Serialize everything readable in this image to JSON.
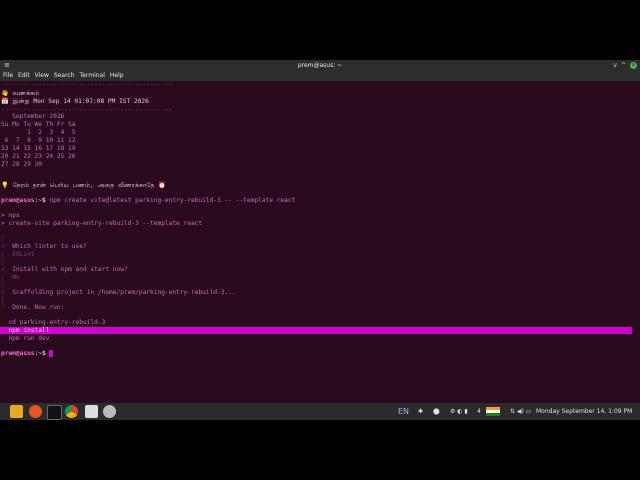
{
  "window": {
    "title": "prem@asus: ~",
    "controls": [
      "v",
      "^",
      "x"
    ]
  },
  "menu": [
    "File",
    "Edit",
    "View",
    "Search",
    "Terminal",
    "Help"
  ],
  "terminal": {
    "header_divider": "----------------------------------------------",
    "greeting_icon": "👋",
    "greeting": "வணக்கம்",
    "date_icon": "📅",
    "date_prefix": "இன்று",
    "date": "Mon Sep 14 01:07:08 PM IST 2026",
    "calendar": {
      "month": "   September 2026",
      "days_header": "Su Mo Tu We Th Fr Sa",
      "weeks": [
        "       1  2  3  4  5",
        " 6  7  8  9 10 11 12",
        "13 14 15 16 17 18 19",
        "20 21 22 23 24 25 26",
        "27 28 29 30"
      ]
    },
    "tip_icon": "💡",
    "tip": "நேரம் தான் பெரிய பணம், அதை வீணாக்காதே ⏰",
    "prompt_user": "prem@asus",
    "prompt_path": ":~$",
    "command": " npm create vite@latest parking-entry-rebuild-3 -- --template react",
    "npx_lines": [
      "> npx",
      "> create-vite parking-entry-rebuild-3 --template react"
    ],
    "wizard": [
      {
        "q": "Which linter to use?",
        "a": "ESLint"
      },
      {
        "q": "Install with npm and start now?",
        "a": "No"
      }
    ],
    "scaffold": "Scaffolding project in /home/prem/parking-entry-rebuild-3...",
    "done": "Done. Now run:",
    "next_steps": [
      "cd parking-entry-rebuild-3",
      "npm install",
      "npm run dev"
    ],
    "final_prompt_user": "prem@asus",
    "final_prompt_path": ":~$"
  },
  "taskbar": {
    "apps": [
      "files-icon",
      "ubuntu-icon",
      "terminal-icon",
      "chrome-icon",
      "text-editor-icon",
      "settings-icon"
    ],
    "language": "EN",
    "battery_level": "4",
    "clock": "Monday September 14,  1:09 PM"
  }
}
